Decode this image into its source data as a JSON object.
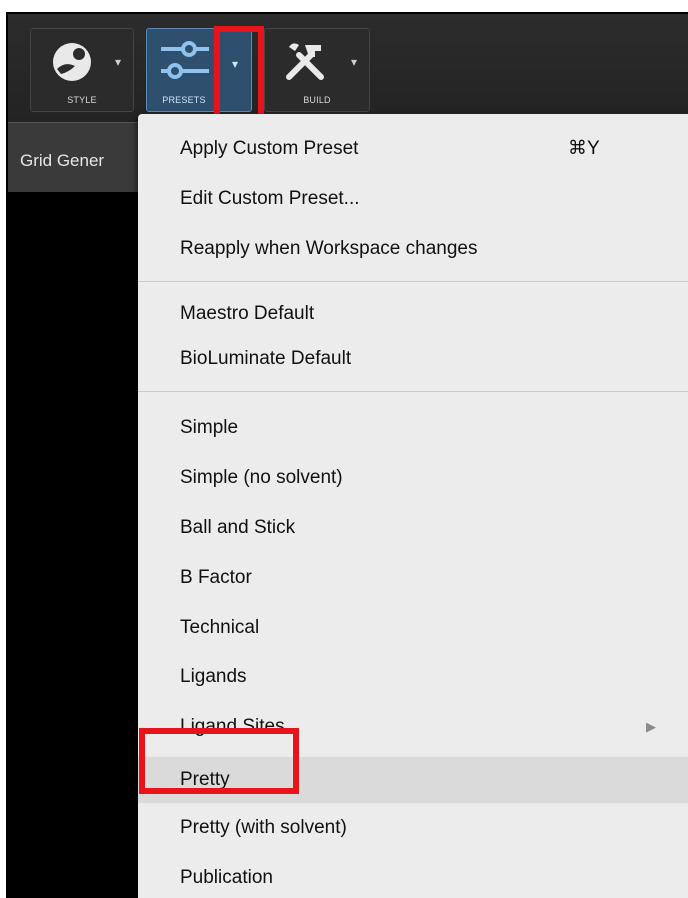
{
  "toolbar": {
    "style_label": "STYLE",
    "presets_label": "PRESETS",
    "build_label": "BUILD",
    "caret": "▾"
  },
  "subbar": {
    "label": "Grid Gener"
  },
  "menu": {
    "apply_custom_preset": "Apply Custom Preset",
    "apply_custom_preset_shortcut": "⌘Y",
    "edit_custom_preset": "Edit Custom Preset...",
    "reapply": "Reapply when Workspace changes",
    "maestro_default": "Maestro Default",
    "bioluminate_default": "BioLuminate Default",
    "simple": "Simple",
    "simple_no_solvent": "Simple (no solvent)",
    "ball_and_stick": "Ball and Stick",
    "b_factor": "B Factor",
    "technical": "Technical",
    "ligands": "Ligands",
    "ligand_sites": "Ligand Sites",
    "ligand_sites_arrow": "▶",
    "pretty": "Pretty",
    "pretty_with_solvent": "Pretty (with solvent)",
    "publication": "Publication"
  },
  "colors": {
    "highlight_box": "#e8131b",
    "menu_bg": "#ececec",
    "menu_highlight": "#dadada",
    "presets_active": "#2e4f6e"
  }
}
